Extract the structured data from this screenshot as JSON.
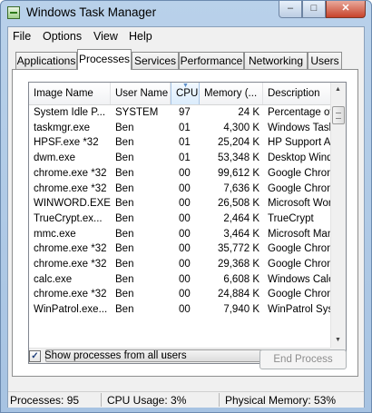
{
  "window": {
    "title": "Windows Task Manager",
    "minimize": "–",
    "maximize": "□",
    "close": "✕"
  },
  "menu": [
    "File",
    "Options",
    "View",
    "Help"
  ],
  "tabs": [
    "Applications",
    "Processes",
    "Services",
    "Performance",
    "Networking",
    "Users"
  ],
  "active_tab": "Processes",
  "columns": [
    "Image Name",
    "User Name",
    "CPU",
    "Memory (...",
    "Description"
  ],
  "sorted_column": "CPU",
  "rows": [
    [
      "System Idle P...",
      "SYSTEM",
      "97",
      "24 K",
      "Percentage of t"
    ],
    [
      "taskmgr.exe",
      "Ben",
      "01",
      "4,300 K",
      "Windows Task"
    ],
    [
      "HPSF.exe *32",
      "Ben",
      "01",
      "25,204 K",
      "HP Support Ass"
    ],
    [
      "dwm.exe",
      "Ben",
      "01",
      "53,348 K",
      "Desktop Wind"
    ],
    [
      "chrome.exe *32",
      "Ben",
      "00",
      "99,612 K",
      "Google Chrom"
    ],
    [
      "chrome.exe *32",
      "Ben",
      "00",
      "7,636 K",
      "Google Chrom"
    ],
    [
      "WINWORD.EXE",
      "Ben",
      "00",
      "26,508 K",
      "Microsoft Wor"
    ],
    [
      "TrueCrypt.ex...",
      "Ben",
      "00",
      "2,464 K",
      "TrueCrypt"
    ],
    [
      "mmc.exe",
      "Ben",
      "00",
      "3,464 K",
      "Microsoft Man"
    ],
    [
      "chrome.exe *32",
      "Ben",
      "00",
      "35,772 K",
      "Google Chrom"
    ],
    [
      "chrome.exe *32",
      "Ben",
      "00",
      "29,368 K",
      "Google Chrom"
    ],
    [
      "calc.exe",
      "Ben",
      "00",
      "6,608 K",
      "Windows Calc"
    ],
    [
      "chrome.exe *32",
      "Ben",
      "00",
      "24,884 K",
      "Google Chrom"
    ],
    [
      "WinPatrol.exe...",
      "Ben",
      "00",
      "7,940 K",
      "WinPatrol Sys"
    ]
  ],
  "show_all_processes": {
    "label": "Show processes from all users",
    "checked": true
  },
  "end_process_label": "End Process",
  "status": {
    "processes": "Processes: 95",
    "cpu": "CPU Usage: 3%",
    "memory": "Physical Memory: 53%"
  },
  "colors": {
    "title_bar": "#b9d1ea",
    "sorted_header": "#dbecfc",
    "close_button": "#c7432b"
  }
}
